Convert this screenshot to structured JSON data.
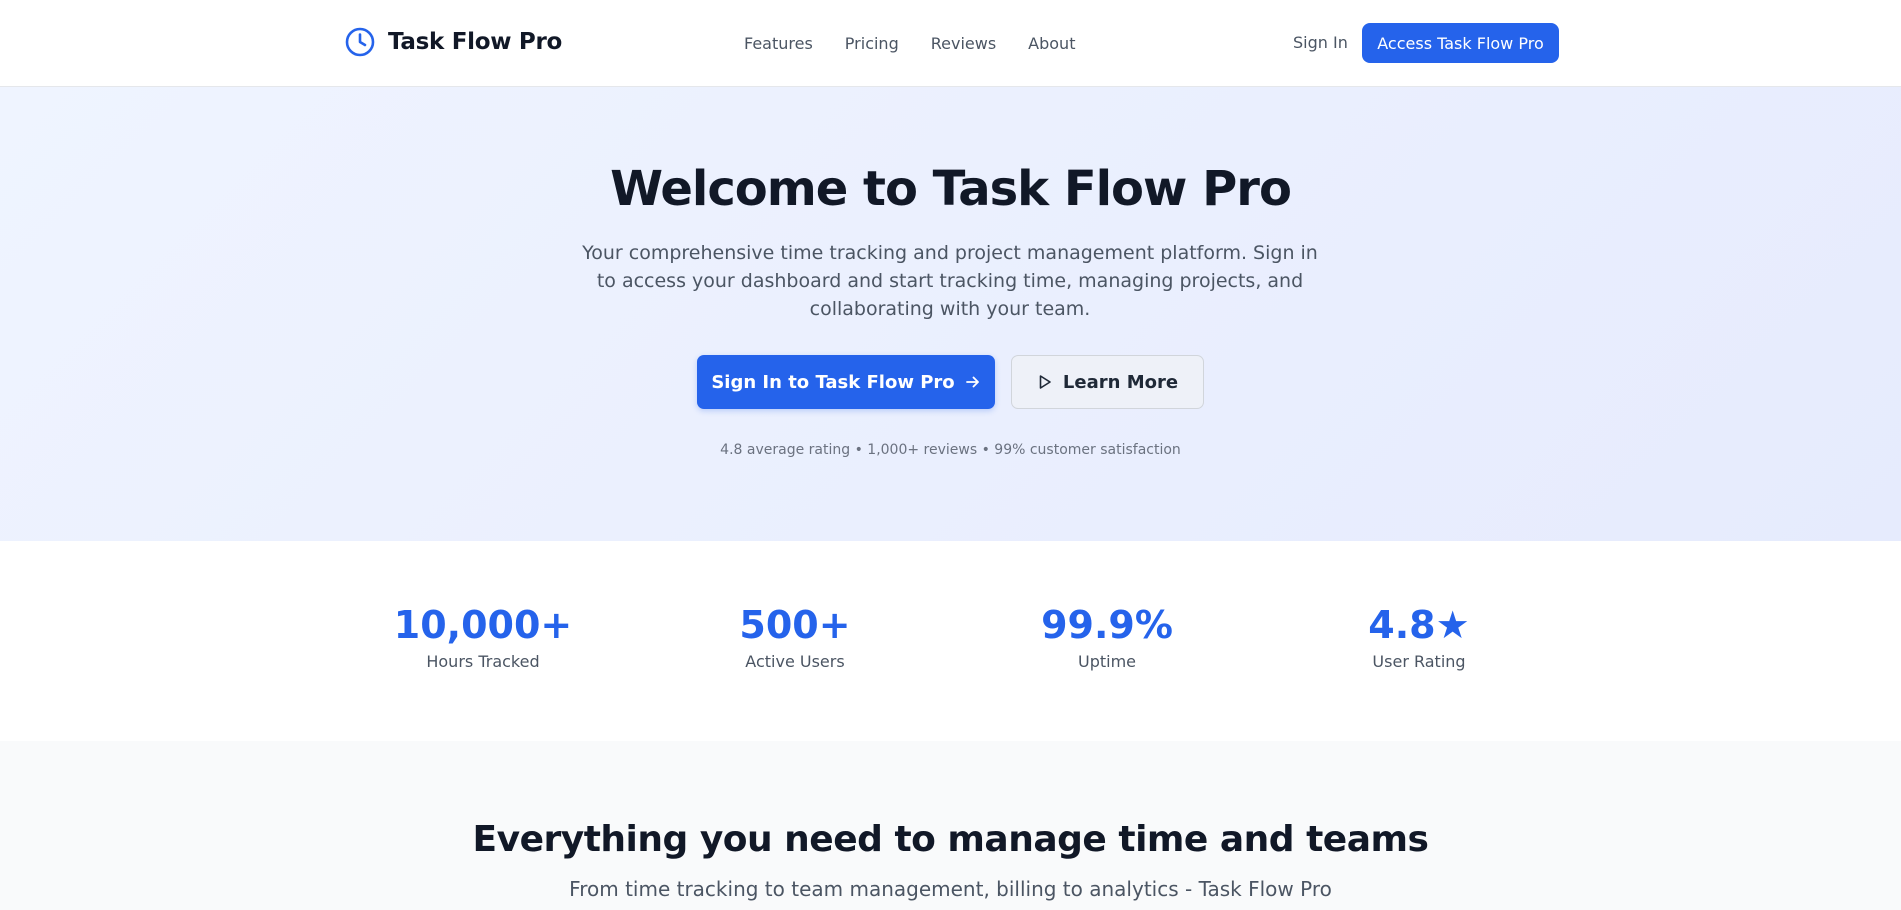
{
  "header": {
    "brand_name": "Task Flow Pro",
    "brand_icon": "clock-icon",
    "nav": [
      "Features",
      "Pricing",
      "Reviews",
      "About"
    ],
    "sign_in": "Sign In",
    "cta": "Access Task Flow Pro"
  },
  "hero": {
    "title": "Welcome to Task Flow Pro",
    "subtitle": "Your comprehensive time tracking and project management platform. Sign in to access your dashboard and start tracking time, managing projects, and collaborating with your team.",
    "primary_button": "Sign In to Task Flow Pro",
    "primary_icon": "arrow-right-icon",
    "secondary_button": "Learn More",
    "secondary_icon": "play-icon",
    "meta": "4.8 average rating • 1,000+ reviews • 99% customer satisfaction"
  },
  "stats": [
    {
      "value": "10,000+",
      "label": "Hours Tracked"
    },
    {
      "value": "500+",
      "label": "Active Users"
    },
    {
      "value": "99.9%",
      "label": "Uptime"
    },
    {
      "value": "4.8★",
      "label": "User Rating"
    }
  ],
  "features": {
    "title": "Everything you need to manage time and teams",
    "subtitle": "From time tracking to team management, billing to analytics - Task Flow Pro"
  },
  "colors": {
    "accent": "#2563eb",
    "text_dark": "#111827",
    "text_muted": "#4b5563",
    "hero_bg_start": "#eff4ff",
    "hero_bg_end": "#e6ebfd"
  }
}
